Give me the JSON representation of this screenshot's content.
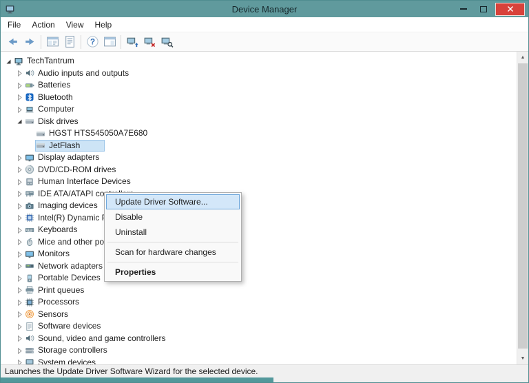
{
  "window": {
    "title": "Device Manager",
    "accent_color": "#609a9d",
    "close_button_color": "#d8423b"
  },
  "menubar": {
    "items": [
      "File",
      "Action",
      "View",
      "Help"
    ]
  },
  "toolbar": {
    "icons": [
      "back-icon",
      "forward-icon",
      "separator",
      "console-tree-icon",
      "properties-icon",
      "separator",
      "help-icon",
      "action-pane-icon",
      "separator",
      "update-driver-icon",
      "uninstall-icon",
      "scan-hardware-icon"
    ]
  },
  "tree": {
    "items": [
      {
        "label": "TechTantrum",
        "level": 0,
        "icon": "computer-icon",
        "expander": "expanded"
      },
      {
        "label": "Audio inputs and outputs",
        "level": 1,
        "icon": "audio-icon",
        "expander": "collapsed"
      },
      {
        "label": "Batteries",
        "level": 1,
        "icon": "battery-icon",
        "expander": "collapsed"
      },
      {
        "label": "Bluetooth",
        "level": 1,
        "icon": "bluetooth-icon",
        "expander": "collapsed"
      },
      {
        "label": "Computer",
        "level": 1,
        "icon": "laptop-icon",
        "expander": "collapsed"
      },
      {
        "label": "Disk drives",
        "level": 1,
        "icon": "disk-icon",
        "expander": "expanded"
      },
      {
        "label": "HGST HTS545050A7E680",
        "level": 2,
        "icon": "disk-icon",
        "expander": "none"
      },
      {
        "label": "JetFlash",
        "level": 2,
        "icon": "disk-icon",
        "expander": "none",
        "selected": true
      },
      {
        "label": "Display adapters",
        "level": 1,
        "icon": "display-icon",
        "expander": "collapsed"
      },
      {
        "label": "DVD/CD-ROM drives",
        "level": 1,
        "icon": "dvd-icon",
        "expander": "collapsed"
      },
      {
        "label": "Human Interface Devices",
        "level": 1,
        "icon": "hid-icon",
        "expander": "collapsed"
      },
      {
        "label": "IDE ATA/ATAPI controllers",
        "level": 1,
        "icon": "ide-icon",
        "expander": "collapsed"
      },
      {
        "label": "Imaging devices",
        "level": 1,
        "icon": "camera-icon",
        "expander": "collapsed"
      },
      {
        "label": "Intel(R) Dynamic Platform",
        "level": 1,
        "icon": "chip-icon",
        "expander": "collapsed"
      },
      {
        "label": "Keyboards",
        "level": 1,
        "icon": "keyboard-icon",
        "expander": "collapsed"
      },
      {
        "label": "Mice and other pointing devices",
        "level": 1,
        "icon": "mouse-icon",
        "expander": "collapsed"
      },
      {
        "label": "Monitors",
        "level": 1,
        "icon": "monitor-icon",
        "expander": "collapsed"
      },
      {
        "label": "Network adapters",
        "level": 1,
        "icon": "network-icon",
        "expander": "collapsed"
      },
      {
        "label": "Portable Devices",
        "level": 1,
        "icon": "portable-icon",
        "expander": "collapsed"
      },
      {
        "label": "Print queues",
        "level": 1,
        "icon": "printer-icon",
        "expander": "collapsed"
      },
      {
        "label": "Processors",
        "level": 1,
        "icon": "processor-icon",
        "expander": "collapsed"
      },
      {
        "label": "Sensors",
        "level": 1,
        "icon": "sensor-icon",
        "expander": "collapsed"
      },
      {
        "label": "Software devices",
        "level": 1,
        "icon": "software-icon",
        "expander": "collapsed"
      },
      {
        "label": "Sound, video and game controllers",
        "level": 1,
        "icon": "sound-icon",
        "expander": "collapsed"
      },
      {
        "label": "Storage controllers",
        "level": 1,
        "icon": "storage-icon",
        "expander": "collapsed"
      },
      {
        "label": "System devices",
        "level": 1,
        "icon": "system-icon",
        "expander": "collapsed"
      }
    ]
  },
  "context_menu": {
    "items": [
      {
        "label": "Update Driver Software...",
        "state": "hover"
      },
      {
        "label": "Disable"
      },
      {
        "label": "Uninstall"
      },
      {
        "type": "separator"
      },
      {
        "label": "Scan for hardware changes"
      },
      {
        "type": "separator"
      },
      {
        "label": "Properties",
        "bold": true
      }
    ]
  },
  "statusbar": {
    "text": "Launches the Update Driver Software Wizard for the selected device."
  }
}
